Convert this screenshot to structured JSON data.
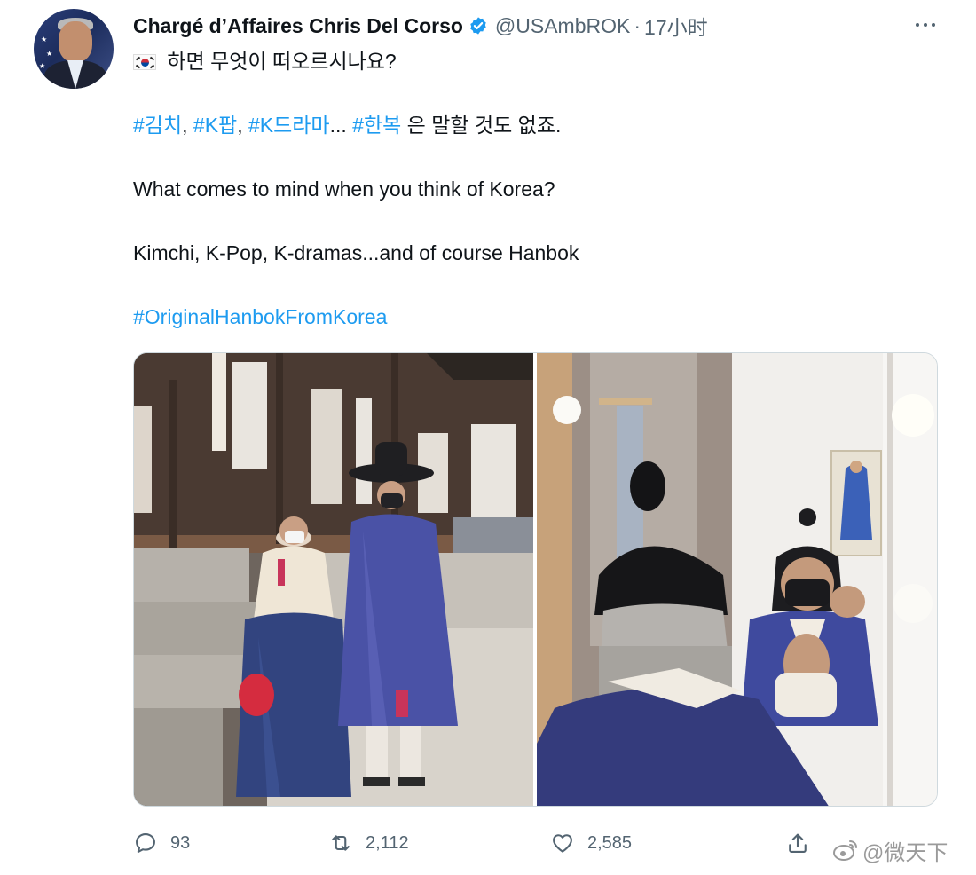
{
  "author": {
    "display_name": "Chargé d’Affaires Chris Del Corso",
    "handle": "@USAmbROK",
    "separator": "·",
    "time": "17小时"
  },
  "tweet": {
    "line1_text": " 하면 무엇이 떠오르시나요?",
    "flag_icon": "south-korea-flag-icon",
    "hashtags_line": [
      {
        "text": "#김치",
        "link": true
      },
      {
        "text": ", ",
        "link": false
      },
      {
        "text": "#K팝",
        "link": true
      },
      {
        "text": ", ",
        "link": false
      },
      {
        "text": "#K드라마",
        "link": true
      },
      {
        "text": "... ",
        "link": false
      },
      {
        "text": "#한복",
        "link": true
      },
      {
        "text": " 은 말할 것도 없죠.",
        "link": false
      }
    ],
    "english_question": "What comes to mind when you think of Korea?",
    "english_answer": "Kimchi, K-Pop, K-dramas...and of course Hanbok",
    "closing_hashtag": "#OriginalHanbokFromKorea"
  },
  "actions": {
    "reply_count": "93",
    "retweet_count": "2,112",
    "like_count": "2,585",
    "icons": [
      "reply-icon",
      "retweet-icon",
      "like-icon",
      "share-icon"
    ]
  },
  "watermark": {
    "text": "@微天下",
    "icon": "weibo-logo"
  },
  "colors": {
    "link": "#1d9bf0",
    "secondary_text": "#536471",
    "verified": "#1d9bf0",
    "hanbok_blue": "#3f4a9e"
  }
}
